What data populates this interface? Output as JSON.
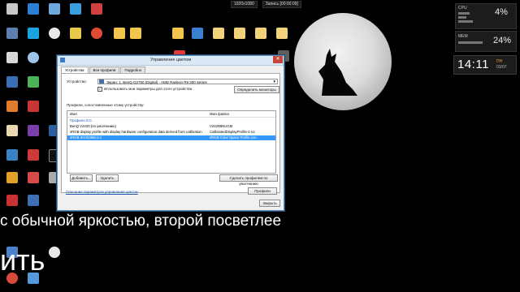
{
  "topbar": {
    "resolution": "1920x1080",
    "recording": "Запись [00:00:09]"
  },
  "gadgets": {
    "cpu_label": "CPU",
    "cpu_value": "4%",
    "mem_label": "MEM",
    "mem_value": "24%"
  },
  "clock": {
    "time": "14:11",
    "day": "ПН",
    "date": "03/07"
  },
  "dialog": {
    "title": "Управление цветом",
    "close": "✕",
    "tabs": [
      "Устройства",
      "Все профили",
      "Подробно"
    ],
    "device_label": "Устройство:",
    "device_value": "Экран: 1. BenQ G2750 (Digital) - AMD Radeon R9 200 Series",
    "use_my_settings": "Использовать мои параметры для этого устройства",
    "identify_monitors": "Определить мониторы",
    "profiles_caption": "Профили, сопоставленные этому устройству:",
    "columns": {
      "name": "Имя",
      "filename": "Имя файла"
    },
    "profiles": [
      {
        "name": "Профили ICC",
        "file": "",
        "type": "group"
      },
      {
        "name": "BenQ V2420 (по умолчанию)",
        "file": "V2420BNUCM",
        "type": "row"
      },
      {
        "name": "sRGB display profile with display hardware configuration data derived from calibration",
        "file": "CalibratedDisplayProfile-2.icc",
        "type": "row"
      },
      {
        "name": "sRGB IEC61966-2.1",
        "file": "sRGB Color Space Profile.icm",
        "type": "selected"
      }
    ],
    "add_button": "Добавить...",
    "remove_button": "Удалить",
    "set_default_button": "Сделать профилем по умолчанию",
    "link_text": "Описание параметров управления цветом",
    "profiles_button": "Профили",
    "close_button": "Закрыть"
  },
  "subtitles": {
    "line1": "с обычной яркостью, второй посветлее",
    "line2": "ить"
  },
  "colors": {
    "selection": "#3399ff",
    "clock_day": "#e7a83a"
  }
}
